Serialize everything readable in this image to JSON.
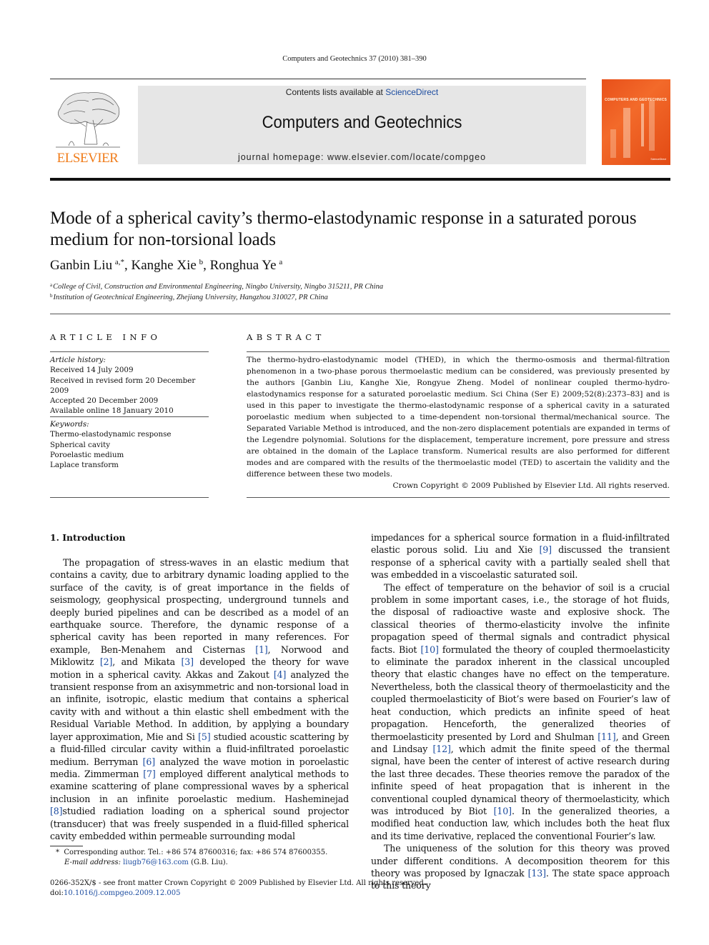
{
  "journal_citation": "Computers and Geotechnics 37 (2010) 381–390",
  "banner": {
    "contents_prefix": "Contents lists available at ",
    "contents_link": "ScienceDirect",
    "journal_title": "Computers and Geotechnics",
    "homepage_prefix": "journal homepage: ",
    "homepage_url": "www.elsevier.com/locate/compgeo",
    "publisher_logo_text": "ELSEVIER",
    "cover_title": "COMPUTERS AND GEOTECHNICS",
    "brand_color": "#f07c1a",
    "link_color": "#1c4ca0"
  },
  "article": {
    "title": "Mode of a spherical cavity’s thermo-elastodynamic response in a saturated porous medium for non-torsional loads",
    "authors": [
      {
        "name": "Ganbin Liu",
        "sup": "a,*"
      },
      {
        "name": "Kanghe Xie",
        "sup": "b"
      },
      {
        "name": "Ronghua Ye",
        "sup": "a"
      }
    ],
    "affiliations": [
      {
        "sup": "a",
        "text": "College of Civil, Construction and Environmental Engineering, Ningbo University, Ningbo 315211, PR China"
      },
      {
        "sup": "b",
        "text": "Institution of Geotechnical Engineering, Zhejiang University, Hangzhou 310027, PR China"
      }
    ]
  },
  "article_info": {
    "heading": "ARTICLE INFO",
    "history_label": "Article history:",
    "history": [
      "Received 14 July 2009",
      "Received in revised form 20 December 2009",
      "Accepted 20 December 2009",
      "Available online 18 January 2010"
    ],
    "keywords_label": "Keywords:",
    "keywords": [
      "Thermo-elastodynamic response",
      "Spherical cavity",
      "Poroelastic medium",
      "Laplace transform"
    ]
  },
  "abstract": {
    "heading": "ABSTRACT",
    "text": "The thermo-hydro-elastodynamic model (THED), in which the thermo-osmosis and thermal-filtration phenomenon in a two-phase porous thermoelastic medium can be considered, was previously presented by the authors [Ganbin Liu, Kanghe Xie, Rongyue Zheng. Model of nonlinear coupled thermo-hydro-elastodynamics response for a saturated poroelastic medium. Sci China (Ser E) 2009;52(8):2373–83] and is used in this paper to investigate the thermo-elastodynamic response of a spherical cavity in a saturated poroelastic medium when subjected to a time-dependent non-torsional thermal/mechanical source. The Separated Variable Method is introduced, and the non-zero displacement potentials are expanded in terms of the Legendre polynomial. Solutions for the displacement, temperature increment, pore pressure and stress are obtained in the domain of the Laplace transform. Numerical results are also performed for different modes and are compared with the results of the thermoelastic model (TED) to ascertain the validity and the difference between these two models.",
    "copyright": "Crown Copyright © 2009 Published by Elsevier Ltd. All rights reserved."
  },
  "body": {
    "section_heading": "1. Introduction",
    "left": {
      "p1": [
        {
          "t": "The propagation of stress-waves in an elastic medium that contains a cavity, due to arbitrary dynamic loading applied to the surface of the cavity, is of great importance in the fields of seismology, geophysical prospecting, underground tunnels and deeply buried pipelines and can be described as a model of an earthquake source. Therefore, the dynamic response of a spherical cavity has been reported in many references. For example, Ben-Menahem and Cisternas "
        },
        {
          "r": "[1]"
        },
        {
          "t": ", Norwood and Miklowitz "
        },
        {
          "r": "[2]"
        },
        {
          "t": ", and Mikata "
        },
        {
          "r": "[3]"
        },
        {
          "t": " developed the theory for wave motion in a spherical cavity. Akkas and Zakout "
        },
        {
          "r": "[4]"
        },
        {
          "t": " analyzed the transient response from an axisymmetric and non-torsional load in an infinite, isotropic, elastic medium that contains a spherical cavity with and without a thin elastic shell embedment with the Residual Variable Method. In addition, by applying a boundary layer approximation, Mie and Si "
        },
        {
          "r": "[5]"
        },
        {
          "t": " studied acoustic scattering by a fluid-filled circular cavity within a fluid-infiltrated poroelastic medium. Berryman "
        },
        {
          "r": "[6]"
        },
        {
          "t": " analyzed the wave motion in poroelastic media. Zimmerman "
        },
        {
          "r": "[7]"
        },
        {
          "t": " employed different analytical methods to examine scattering of plane compressional waves by a spherical inclusion in an infinite poroelastic medium. Hasheminejad "
        },
        {
          "r": "[8]"
        },
        {
          "t": "studied radiation loading on a spherical sound projector (transducer) that was freely suspended in a fluid-filled spherical cavity embedded within permeable surrounding modal"
        }
      ]
    },
    "right": {
      "p0": [
        {
          "t": "impedances for a spherical source formation in a fluid-infiltrated elastic porous solid. Liu and Xie "
        },
        {
          "r": "[9]"
        },
        {
          "t": " discussed the transient response of a spherical cavity with a partially sealed shell that was embedded in a viscoelastic saturated soil."
        }
      ],
      "p2": [
        {
          "t": "The effect of temperature on the behavior of soil is a crucial problem in some important cases, i.e., the storage of hot fluids, the disposal of radioactive waste and explosive shock. The classical theories of thermo-elasticity involve the infinite propagation speed of thermal signals and contradict physical facts. Biot "
        },
        {
          "r": "[10]"
        },
        {
          "t": " formulated the theory of coupled thermoelasticity to eliminate the paradox inherent in the classical uncoupled theory that elastic changes have no effect on the temperature. Nevertheless, both the classical theory of thermoelasticity and the coupled thermoelasticity of Biot’s were based on Fourier’s law of heat conduction, which predicts an infinite speed of heat propagation. Henceforth, the generalized theories of thermoelasticity presented by Lord and Shulman "
        },
        {
          "r": "[11]"
        },
        {
          "t": ", and Green and Lindsay "
        },
        {
          "r": "[12]"
        },
        {
          "t": ", which admit the finite speed of the thermal signal, have been the center of interest of active research during the last three decades. These theories remove the paradox of the infinite speed of heat propagation that is inherent in the conventional coupled dynamical theory of thermoelasticity, which was introduced by Biot "
        },
        {
          "r": "[10]"
        },
        {
          "t": ". In the generalized theories, a modified heat conduction law, which includes both the heat flux and its time derivative, replaced the conventional Fourier’s law."
        }
      ],
      "p3": [
        {
          "t": "The uniqueness of the solution for this theory was proved under different conditions. A decomposition theorem for this theory was proposed by Ignaczak "
        },
        {
          "r": "[13]"
        },
        {
          "t": ". The state space approach to this theory"
        }
      ]
    }
  },
  "footnote": {
    "marker": "*",
    "corresponding": "Corresponding author. Tel.: +86 574 87600316; fax: +86 574 87600355.",
    "email_label": "E-mail address:",
    "email": "liugb76@163.com",
    "email_suffix": " (G.B. Liu)."
  },
  "bottom": {
    "issn_line": "0266-352X/$ - see front matter Crown Copyright © 2009 Published by Elsevier Ltd. All rights reserved.",
    "doi_prefix": "doi:",
    "doi": "10.1016/j.compgeo.2009.12.005"
  }
}
